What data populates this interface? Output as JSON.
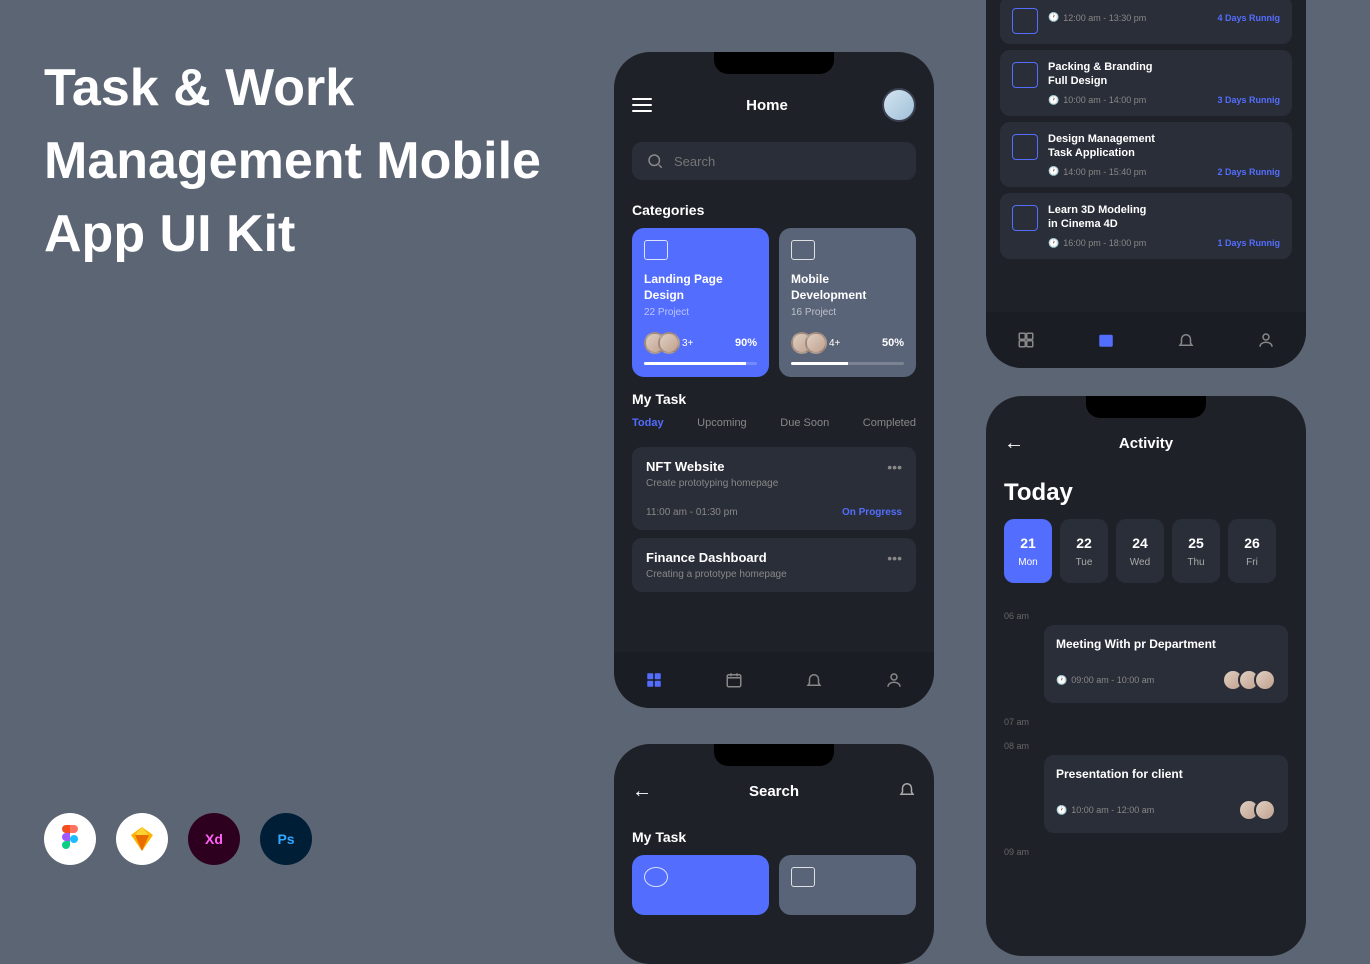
{
  "hero": "Task & Work Management Mobile App UI Kit",
  "tools": [
    "figma",
    "sketch",
    "xd",
    "photoshop"
  ],
  "home": {
    "title": "Home",
    "search_placeholder": "Search",
    "categories_label": "Categories",
    "categories": [
      {
        "title": "Landing Page Design",
        "sub": "22 Project",
        "extra": "3+",
        "pct": "90%",
        "fill": 90
      },
      {
        "title": "Mobile Development",
        "sub": "16 Project",
        "extra": "4+",
        "pct": "50%",
        "fill": 50
      }
    ],
    "mytask_label": "My Task",
    "tabs": [
      "Today",
      "Upcoming",
      "Due Soon",
      "Completed"
    ],
    "tasks": [
      {
        "title": "NFT Website",
        "sub": "Create prototyping homepage",
        "time": "11:00 am - 01:30 pm",
        "status": "On Progress"
      },
      {
        "title": "Finance Dashboard",
        "sub": "Creating a prototype homepage",
        "time": "",
        "status": ""
      }
    ]
  },
  "search": {
    "title": "Search",
    "mytask_label": "My Task"
  },
  "schedule": {
    "items": [
      {
        "title": "",
        "line2": "",
        "time": "12:00 am - 13:30 pm",
        "badge": "4 Days Runnig"
      },
      {
        "title": "Packing & Branding",
        "line2": "Full Design",
        "time": "10:00 am - 14:00 pm",
        "badge": "3 Days Runnig"
      },
      {
        "title": "Design Management",
        "line2": "Task  Application",
        "time": "14:00 pm - 15:40 pm",
        "badge": "2 Days Runnig"
      },
      {
        "title": "Learn 3D Modeling",
        "line2": "in Cinema 4D",
        "time": "16:00 pm - 18:00 pm",
        "badge": "1 Days Runnig"
      }
    ]
  },
  "activity": {
    "title": "Activity",
    "heading": "Today",
    "days": [
      {
        "num": "21",
        "name": "Mon",
        "active": true
      },
      {
        "num": "22",
        "name": "Tue"
      },
      {
        "num": "24",
        "name": "Wed"
      },
      {
        "num": "25",
        "name": "Thu"
      },
      {
        "num": "26",
        "name": "Fri"
      }
    ],
    "time_labels": [
      "06 am",
      "07 am",
      "08 am",
      "09 am"
    ],
    "events": [
      {
        "title": "Meeting With pr Department",
        "time": "09:00 am - 10:00 am",
        "avatars": 3
      },
      {
        "title": "Presentation for client",
        "time": "10:00 am - 12:00 am",
        "avatars": 2
      }
    ]
  }
}
